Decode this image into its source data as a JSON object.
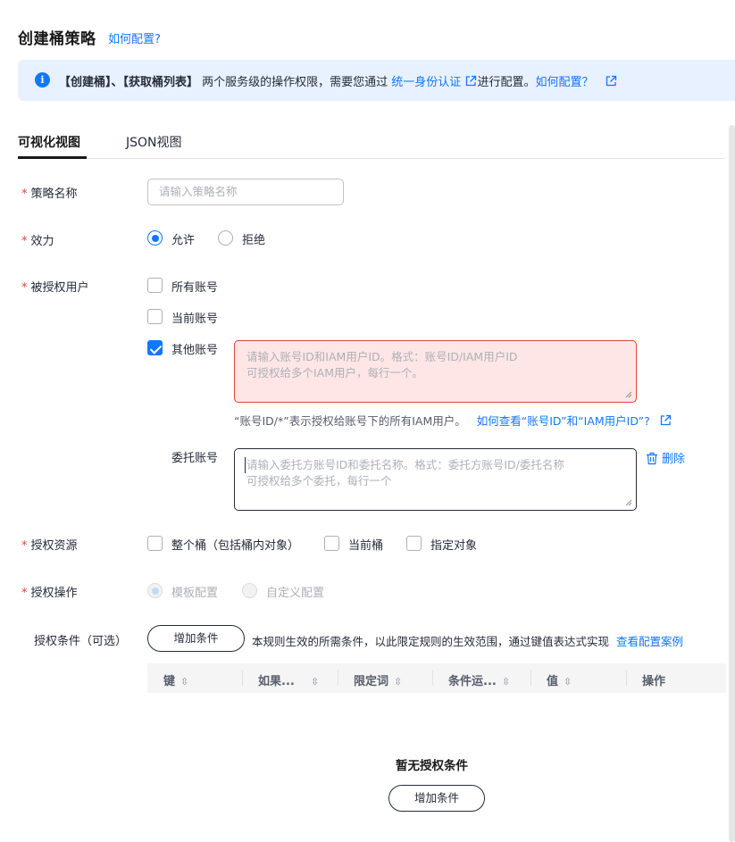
{
  "page": {
    "title": "创建桶策略",
    "howto_link": "如何配置?"
  },
  "notice": {
    "part1": "【创建桶】、【获取桶列表】",
    "part2": " 两个服务级的操作权限，需要您通过 ",
    "iam_link": "统一身份认证",
    "part3": "进行配置。",
    "howto_link": "如何配置？"
  },
  "tabs": {
    "visual": "可视化视图",
    "json": "JSON视图"
  },
  "form": {
    "required_mark": "*",
    "policy_name": {
      "label": "策略名称",
      "placeholder": "请输入策略名称"
    },
    "effect": {
      "label": "效力",
      "allow": "允许",
      "deny": "拒绝",
      "selected": "允许"
    },
    "principal": {
      "label": "被授权用户",
      "all_accounts": "所有账号",
      "current_account": "当前账号",
      "other_accounts": "其他账号",
      "other_accounts_checked": true,
      "other_placeholder_line1": "请输入账号ID和IAM用户ID。格式：账号ID/IAM用户ID",
      "other_placeholder_line2": "可授权给多个IAM用户，每行一个。",
      "hint_text": "“账号ID/*”表示授权给账号下的所有IAM用户。",
      "hint_link": "如何查看“账号ID”和“IAM用户ID”?",
      "delegated_label": "委托账号",
      "delegated_placeholder_line1": "请输入委托方账号ID和委托名称。格式：委托方账号ID/委托名称",
      "delegated_placeholder_line2": "可授权给多个委托，每行一个",
      "delete_label": "删除"
    },
    "resource": {
      "label": "授权资源",
      "whole_bucket": "整个桶（包括桶内对象）",
      "current_bucket": "当前桶",
      "specified_object": "指定对象"
    },
    "action": {
      "label": "授权操作",
      "template": "模板配置",
      "custom": "自定义配置",
      "selected": "模板配置"
    },
    "conditions": {
      "label": "授权条件（可选）",
      "add_button": "增加条件",
      "description": "本规则生效的所需条件，以此限定规则的生效范围，通过键值表达式实现",
      "example_link": "查看配置案例",
      "columns": [
        "键",
        "如果...",
        "限定词",
        "条件运...",
        "值",
        "操作"
      ],
      "sortable": [
        true,
        true,
        true,
        true,
        true,
        false
      ],
      "empty_text": "暂无授权条件",
      "empty_add_button": "增加条件"
    }
  },
  "colors": {
    "accent": "#1476ff",
    "error": "#e3413f",
    "notice_bg": "#e8f1ff"
  }
}
